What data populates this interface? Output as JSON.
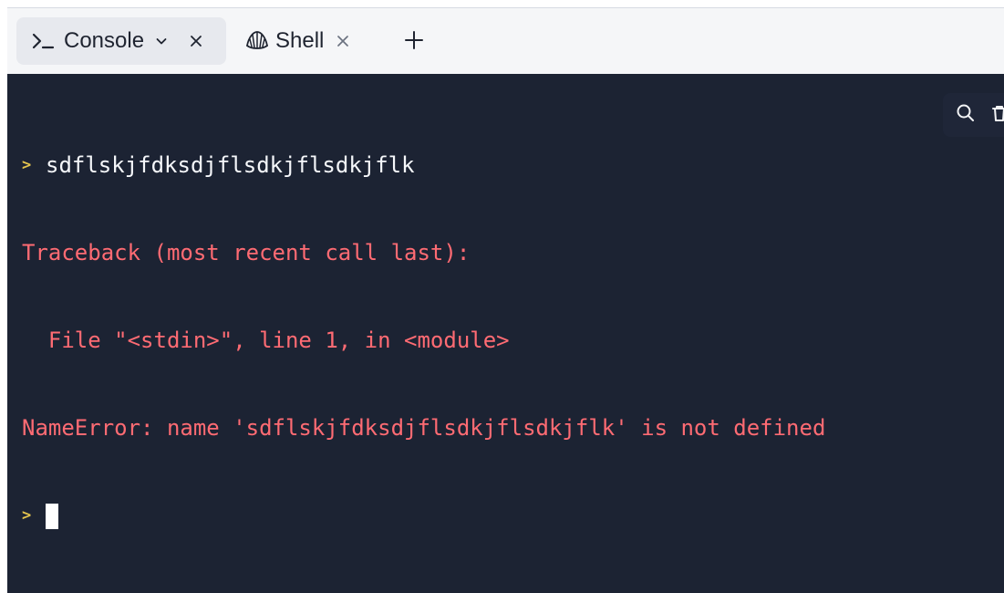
{
  "tabs": {
    "console": {
      "label": "Console",
      "icon": "console-icon"
    },
    "shell": {
      "label": "Shell",
      "icon": "shell-icon"
    },
    "icons": {
      "dropdown": "chevron-down-icon",
      "close": "close-icon",
      "new_tab": "plus-icon"
    }
  },
  "terminal": {
    "lines": [
      {
        "prompt": ">",
        "text": "sdflskjfdksdjflsdkjflsdkjflk"
      },
      {
        "text": "Traceback (most recent call last):"
      },
      {
        "text": "  File \"<stdin>\", line 1, in <module>"
      },
      {
        "text": "NameError: name 'sdflskjfdksdjflsdkjflsdkjflk' is not defined"
      },
      {
        "prompt": ">",
        "text": ""
      }
    ],
    "toolbar": {
      "search_icon": "search-icon",
      "trash_icon": "trash-icon"
    }
  },
  "colors": {
    "terminal_background": "#1c2333",
    "prompt": "#e3c34d",
    "input": "#f5f7fa",
    "error": "#ff6b73",
    "tabbar_background": "#f5f6f8",
    "active_tab_background": "#e7e9ee"
  }
}
